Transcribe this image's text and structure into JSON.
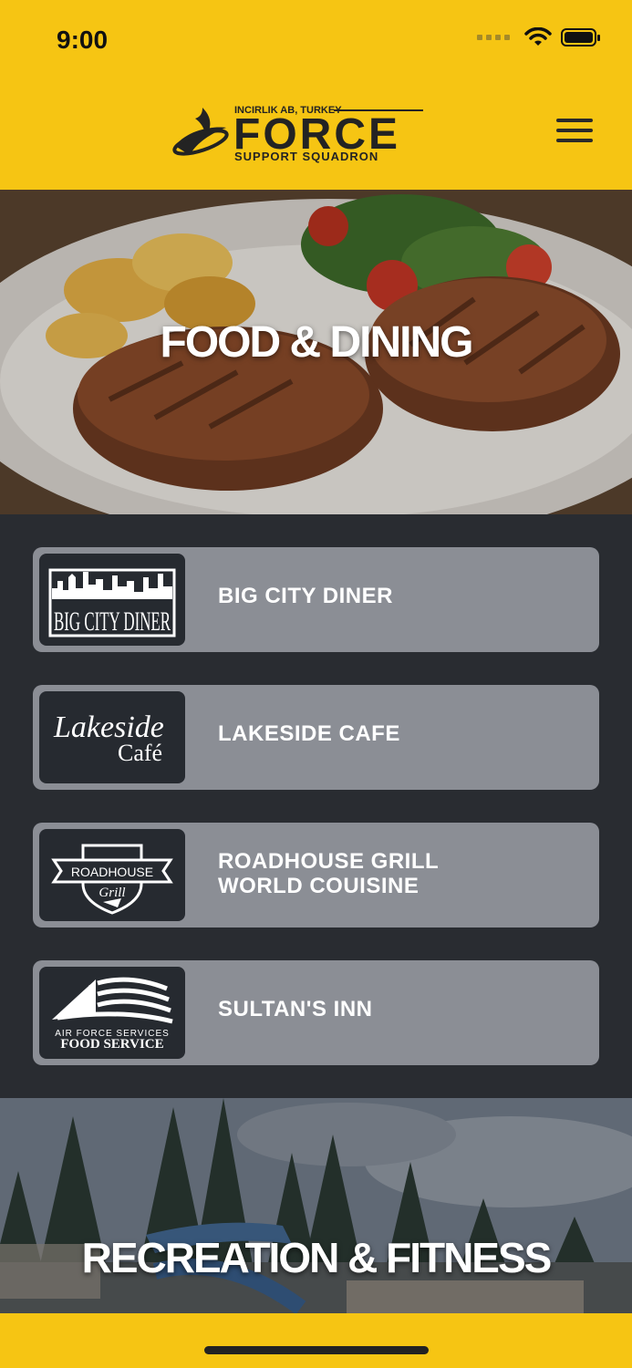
{
  "status_bar": {
    "time": "9:00"
  },
  "header": {
    "logo": {
      "top_line": "INCIRLIK AB, TURKEY",
      "main": "FORCE",
      "bottom_line": "SUPPORT SQUADRON"
    },
    "menu_icon": "hamburger-menu-icon"
  },
  "hero": {
    "title": "FOOD & DINING"
  },
  "restaurants": [
    {
      "name": "BIG CITY DINER",
      "logo_text": "BIG CITY DINER"
    },
    {
      "name": "LAKESIDE CAFE",
      "logo_text": [
        "Lakeside",
        "Café"
      ]
    },
    {
      "name": [
        "ROADHOUSE GRILL",
        "WORLD COUISINE"
      ],
      "logo_text": [
        "ROADHOUSE",
        "Grill"
      ]
    },
    {
      "name": "SULTAN'S INN",
      "logo_text": [
        "AIR FORCE SERVICES",
        "FOOD SERVICE"
      ]
    }
  ],
  "recreation": {
    "title": "RECREATION & FITNESS"
  },
  "colors": {
    "brand_yellow": "#f6c513",
    "card_gray": "#8b8e95",
    "background_dark": "#292c31"
  }
}
